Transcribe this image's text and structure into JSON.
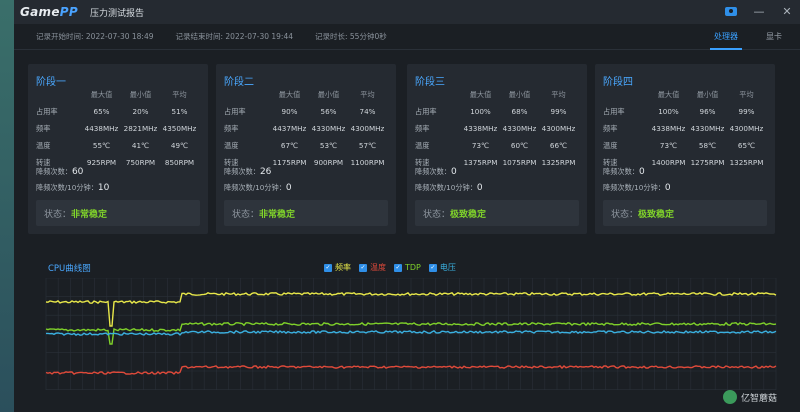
{
  "app": {
    "logo_game": "Game",
    "logo_pp": "PP",
    "window_title": "压力测试报告"
  },
  "titlebar_icons": [
    "camera-icon",
    "minimize-icon",
    "close-icon"
  ],
  "info": {
    "start": "记录开始时间: 2022-07-30 18:49",
    "end": "记录结束时间: 2022-07-30 19:44",
    "duration": "记录时长: 55分钟0秒"
  },
  "tabs": [
    {
      "label": "处理器",
      "active": true
    },
    {
      "label": "显卡",
      "active": false
    }
  ],
  "columns": [
    "最大值",
    "最小值",
    "平均"
  ],
  "labels": {
    "usage": "占用率",
    "freq": "频率",
    "temp": "温度",
    "speed": "转速",
    "throttle": "降频次数：",
    "throttle10": "降频次数/10分钟：",
    "status": "状态："
  },
  "stages": [
    {
      "title": "阶段一",
      "usage": [
        "65%",
        "20%",
        "51%"
      ],
      "freq": [
        "4438MHz",
        "2821MHz",
        "4350MHz"
      ],
      "temp": [
        "55℃",
        "41℃",
        "49℃"
      ],
      "speed": [
        "925RPM",
        "750RPM",
        "850RPM"
      ],
      "throttle": "60",
      "throttle10": "10",
      "status": "非常稳定"
    },
    {
      "title": "阶段二",
      "usage": [
        "90%",
        "56%",
        "74%"
      ],
      "freq": [
        "4437MHz",
        "4330MHz",
        "4300MHz"
      ],
      "temp": [
        "67℃",
        "53℃",
        "57℃"
      ],
      "speed": [
        "1175RPM",
        "900RPM",
        "1100RPM"
      ],
      "throttle": "26",
      "throttle10": "0",
      "status": "非常稳定"
    },
    {
      "title": "阶段三",
      "usage": [
        "100%",
        "68%",
        "99%"
      ],
      "freq": [
        "4338MHz",
        "4330MHz",
        "4300MHz"
      ],
      "temp": [
        "73℃",
        "60℃",
        "66℃"
      ],
      "speed": [
        "1375RPM",
        "1075RPM",
        "1325RPM"
      ],
      "throttle": "0",
      "throttle10": "0",
      "status": "极致稳定"
    },
    {
      "title": "阶段四",
      "usage": [
        "100%",
        "96%",
        "99%"
      ],
      "freq": [
        "4338MHz",
        "4330MHz",
        "4300MHz"
      ],
      "temp": [
        "73℃",
        "58℃",
        "65℃"
      ],
      "speed": [
        "1400RPM",
        "1275RPM",
        "1325RPM"
      ],
      "throttle": "0",
      "throttle10": "0",
      "status": "极致稳定"
    }
  ],
  "chart": {
    "title": "CPU曲线图",
    "legend": [
      {
        "label": "频率",
        "color": "#e8e84a",
        "checked": true
      },
      {
        "label": "温度",
        "color": "#e04a3a",
        "checked": true
      },
      {
        "label": "TDP",
        "color": "#7fd12a",
        "checked": true
      },
      {
        "label": "电压",
        "color": "#3ab0e0",
        "checked": true
      }
    ]
  },
  "watermark": "亿智蘑菇"
}
